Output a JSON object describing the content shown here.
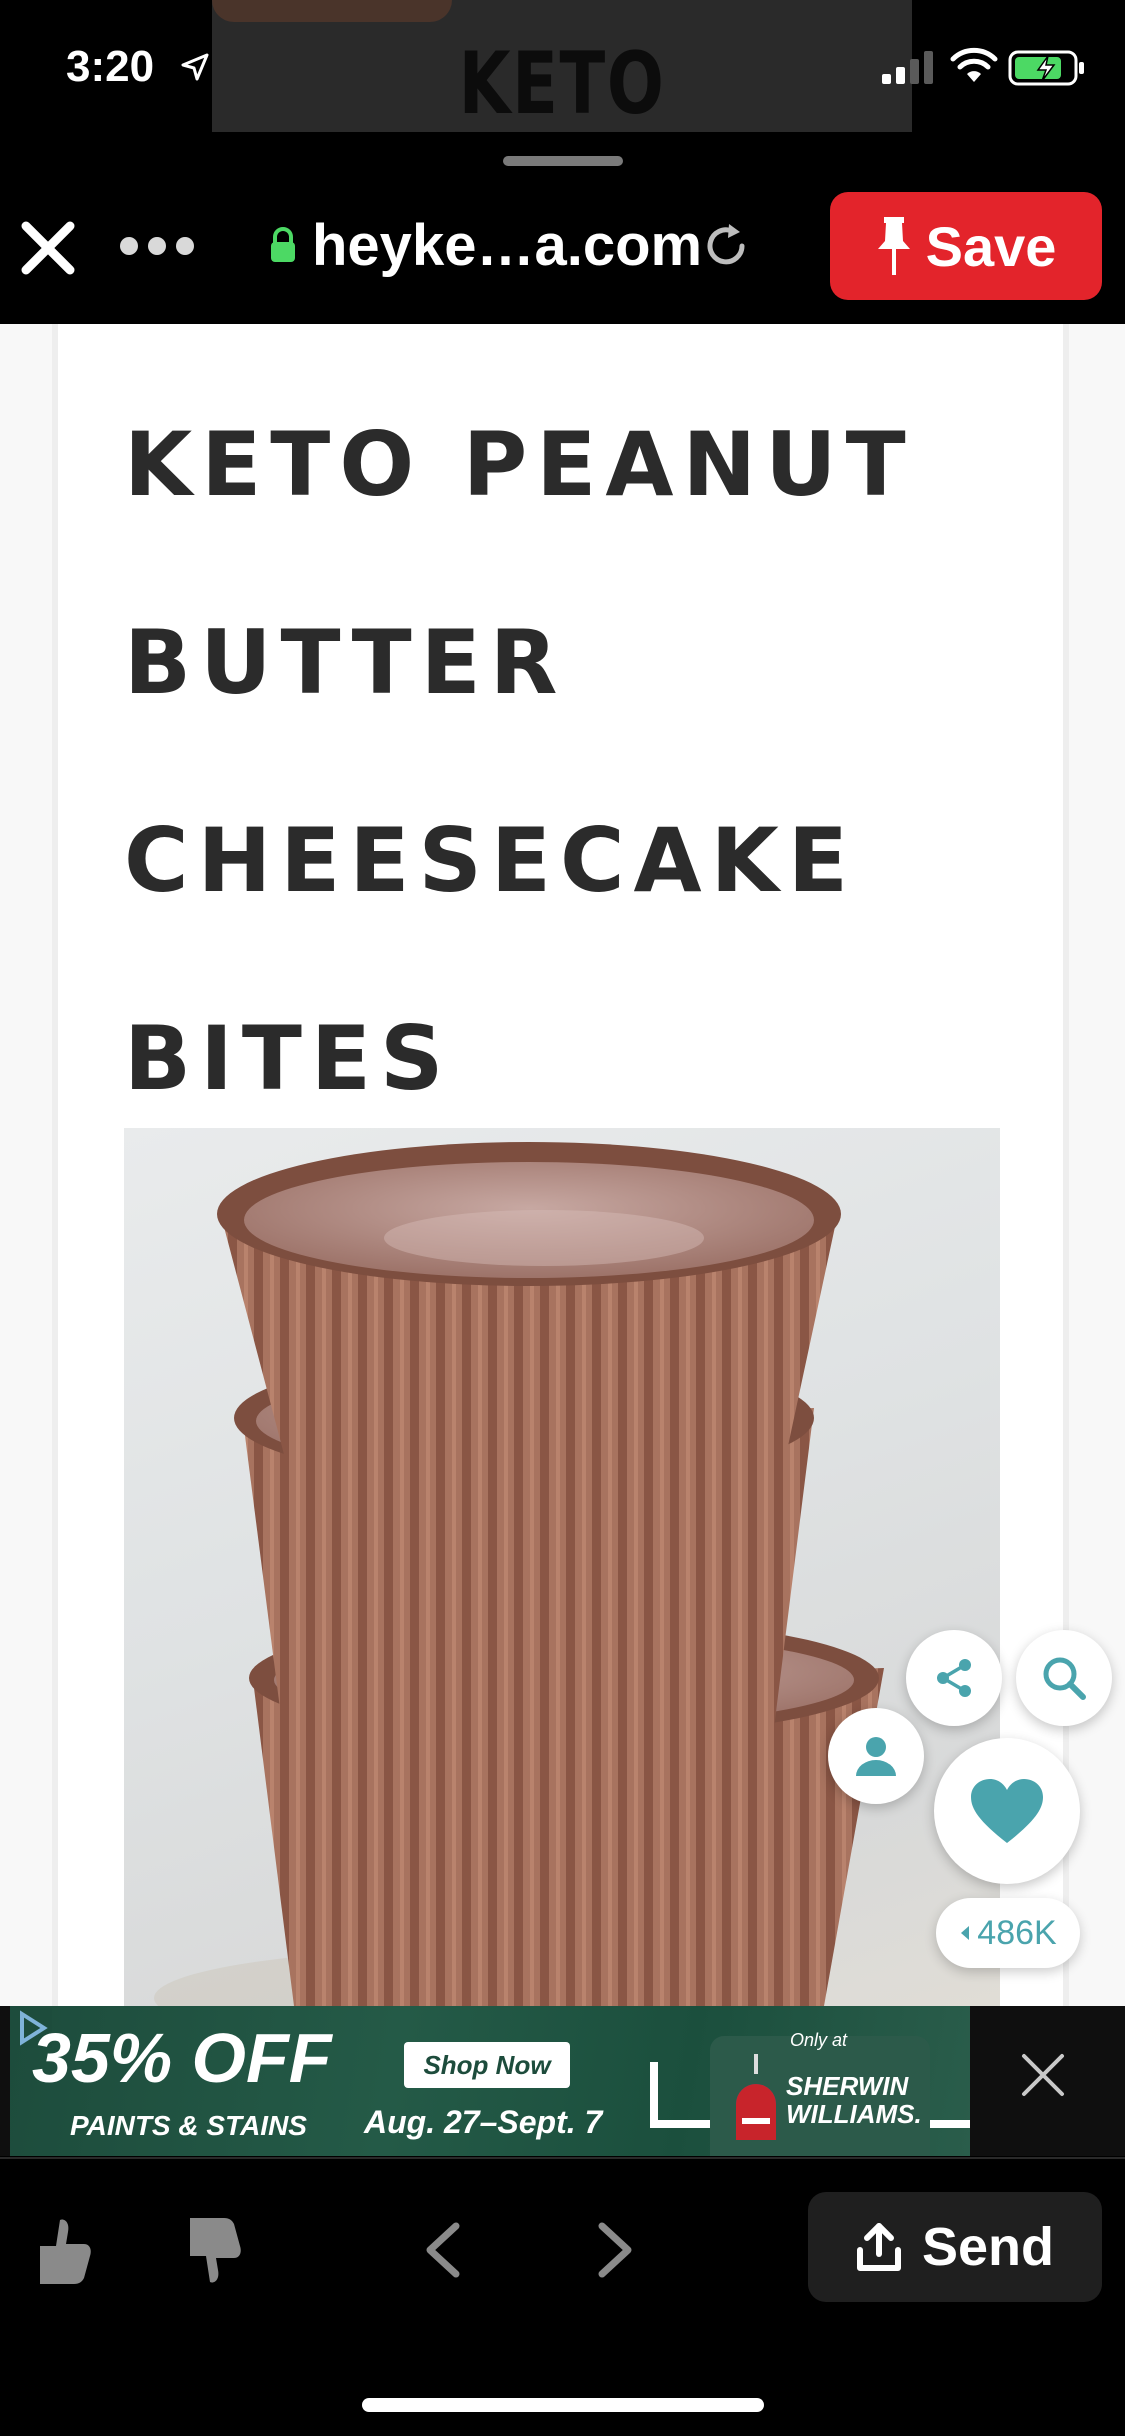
{
  "status_bar": {
    "time": "3:20",
    "site_thumbnail_text": "KETO"
  },
  "browser": {
    "url": "heyke…a.com",
    "save_label": "Save"
  },
  "article": {
    "title_lines": [
      "KETO PEANUT",
      "BUTTER",
      "CHEESECAKE",
      "BITES"
    ]
  },
  "actions": {
    "like_count": "486K",
    "accent_color": "#4aa4ad"
  },
  "ad": {
    "headline": "35% OFF",
    "subline": "PAINTS & STAINS",
    "cta": "Shop Now",
    "dates": "Aug. 27–Sept. 7",
    "only_at": "Only at",
    "brand_line1": "SHERWIN",
    "brand_line2": "WILLIAMS."
  },
  "toolbar": {
    "send_label": "Send"
  },
  "colors": {
    "save_red": "#e3242b",
    "title_text": "#2b2b2b"
  }
}
